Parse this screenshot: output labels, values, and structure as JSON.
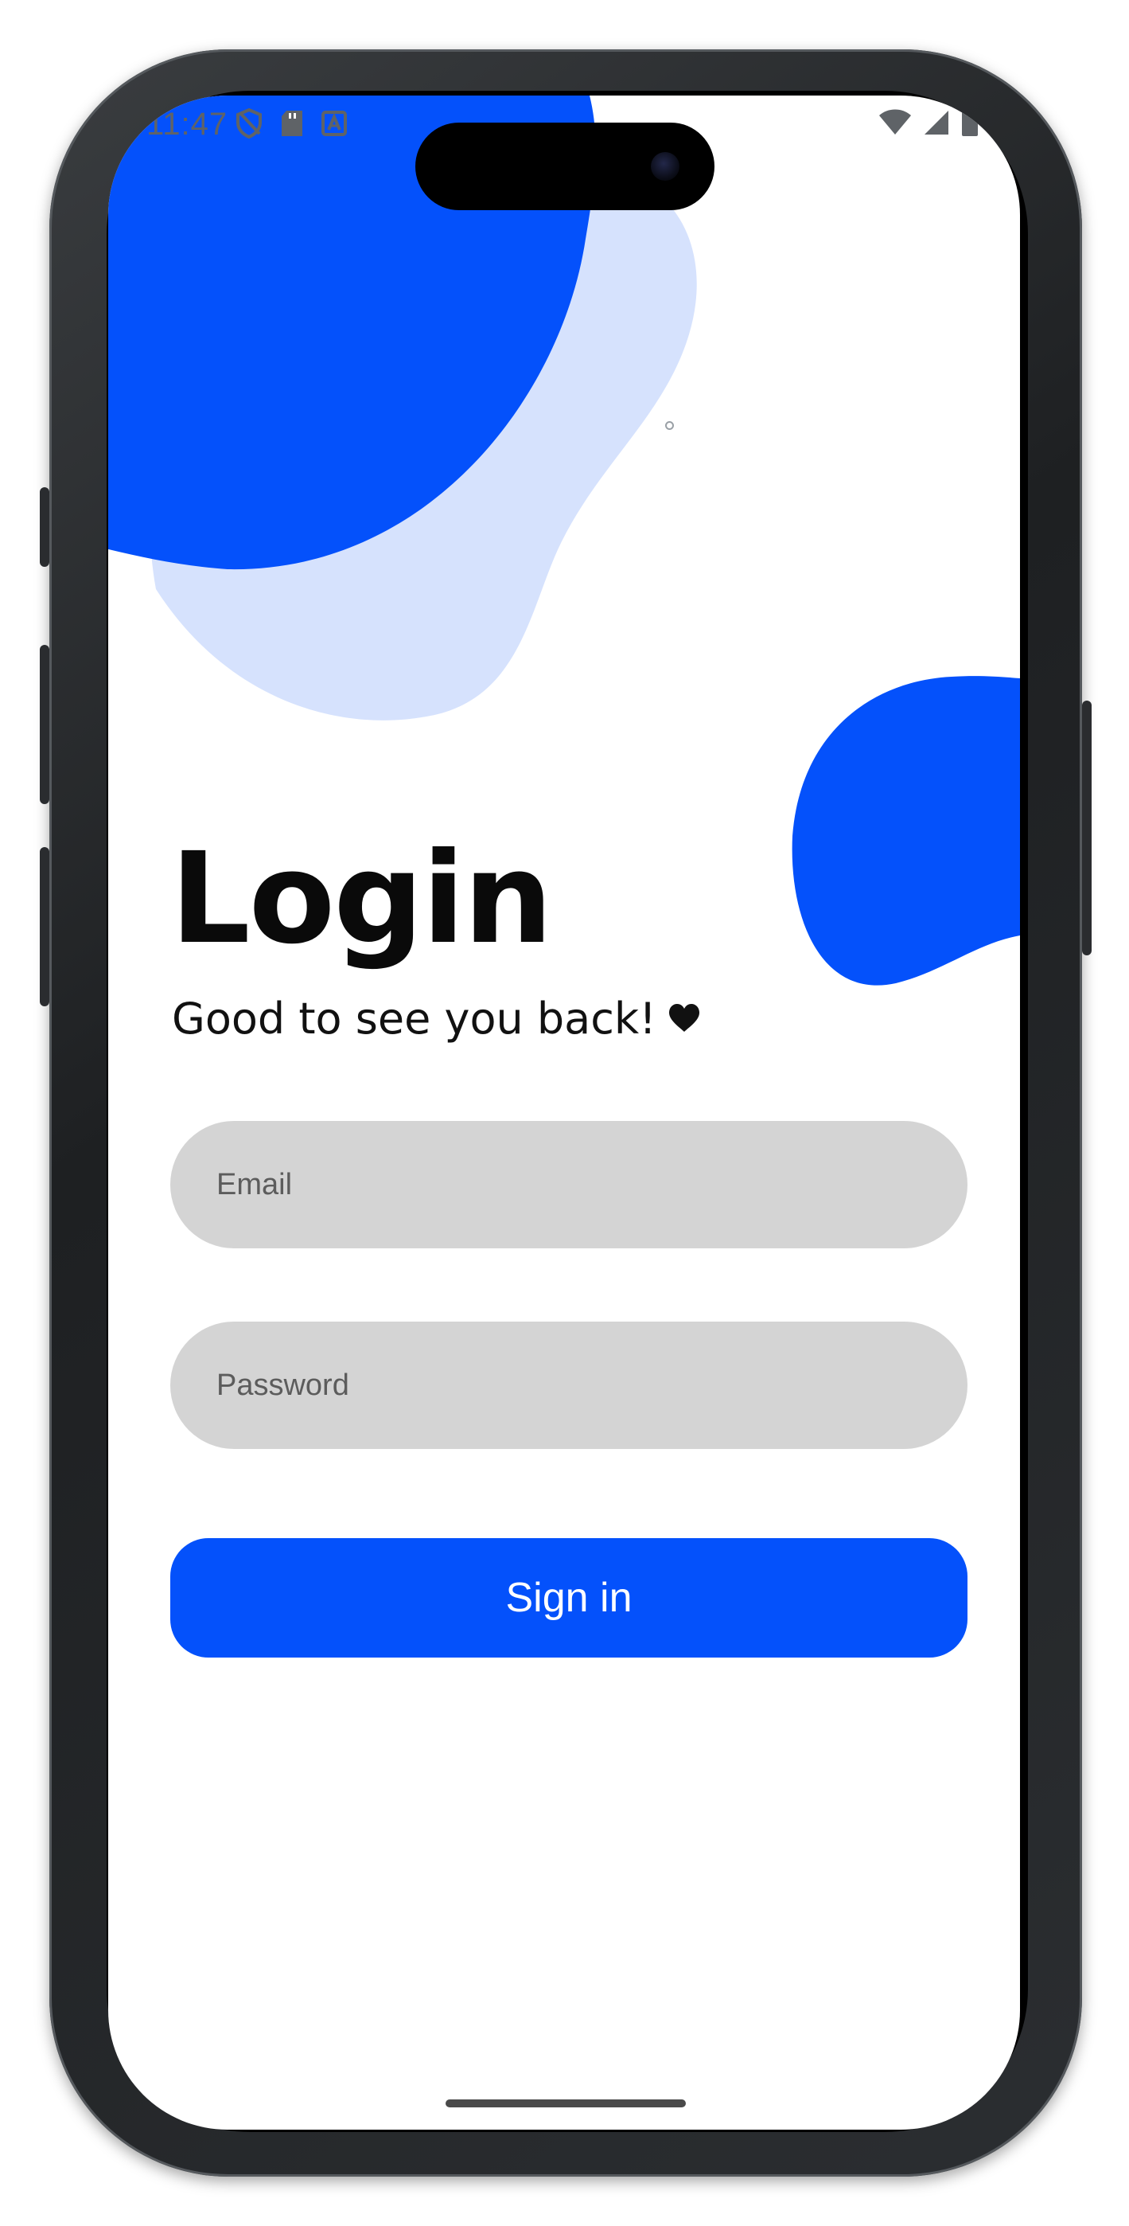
{
  "status_bar": {
    "time": "11:47"
  },
  "login": {
    "title": "Login",
    "subtitle": "Good to see you back!",
    "heart_icon": "heart-icon",
    "email_placeholder": "Email",
    "password_placeholder": "Password",
    "signin_label": "Sign in"
  },
  "colors": {
    "accent": "#0451fb",
    "accent_light": "#d6e2fd",
    "input_bg": "#d4d4d4",
    "text": "#111111"
  },
  "icons": {
    "status_left": [
      "shield-icon",
      "sd-card-icon",
      "app-store-icon"
    ],
    "status_right": [
      "wifi-icon",
      "signal-icon",
      "battery-icon"
    ]
  }
}
